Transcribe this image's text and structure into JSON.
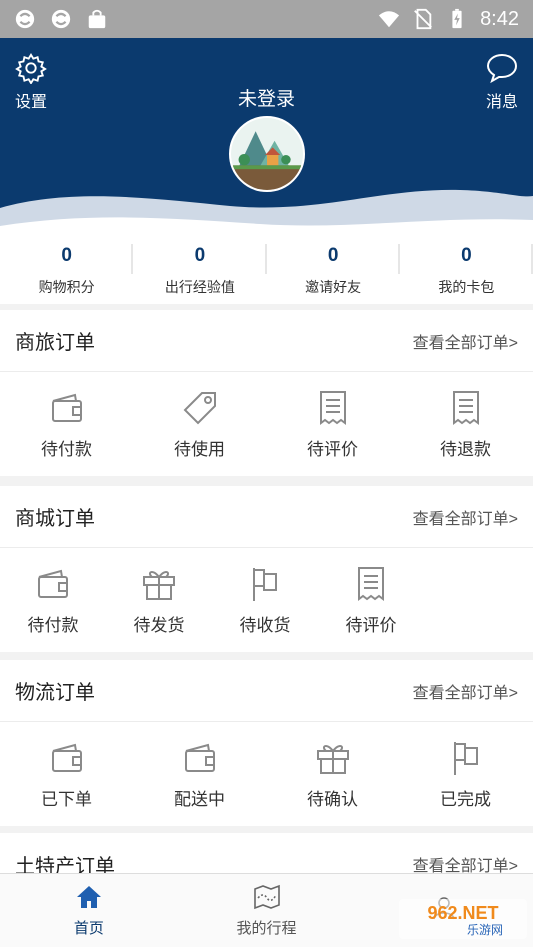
{
  "status_bar": {
    "time": "8:42"
  },
  "header": {
    "settings_label": "设置",
    "messages_label": "消息",
    "login_title": "未登录"
  },
  "stats": [
    {
      "value": "0",
      "label": "购物积分"
    },
    {
      "value": "0",
      "label": "出行经验值"
    },
    {
      "value": "0",
      "label": "邀请好友"
    },
    {
      "value": "0",
      "label": "我的卡包"
    }
  ],
  "sections": {
    "business_travel": {
      "title": "商旅订单",
      "view_all": "查看全部订单>",
      "items": [
        {
          "label": "待付款",
          "icon": "wallet-icon"
        },
        {
          "label": "待使用",
          "icon": "tag-icon"
        },
        {
          "label": "待评价",
          "icon": "receipt-icon"
        },
        {
          "label": "待退款",
          "icon": "receipt-icon"
        }
      ]
    },
    "mall": {
      "title": "商城订单",
      "view_all": "查看全部订单>",
      "items": [
        {
          "label": "待付款",
          "icon": "wallet-icon"
        },
        {
          "label": "待发货",
          "icon": "gift-icon"
        },
        {
          "label": "待收货",
          "icon": "flag-icon"
        },
        {
          "label": "待评价",
          "icon": "receipt-icon"
        }
      ]
    },
    "logistics": {
      "title": "物流订单",
      "view_all": "查看全部订单>",
      "items": [
        {
          "label": "已下单",
          "icon": "wallet-icon"
        },
        {
          "label": "配送中",
          "icon": "wallet-icon"
        },
        {
          "label": "待确认",
          "icon": "gift-icon"
        },
        {
          "label": "已完成",
          "icon": "flag-icon"
        }
      ]
    },
    "specialty": {
      "title": "土特产订单",
      "view_all": "查看全部订单>"
    }
  },
  "tabbar": {
    "home": "首页",
    "my_trips": "我的行程"
  },
  "watermark": {
    "text": "962.NET",
    "subtext": "乐游网"
  },
  "colors": {
    "header_bg": "#0b3a6e",
    "accent": "#0b3a6e",
    "icon_gray": "#8a8a8a"
  }
}
